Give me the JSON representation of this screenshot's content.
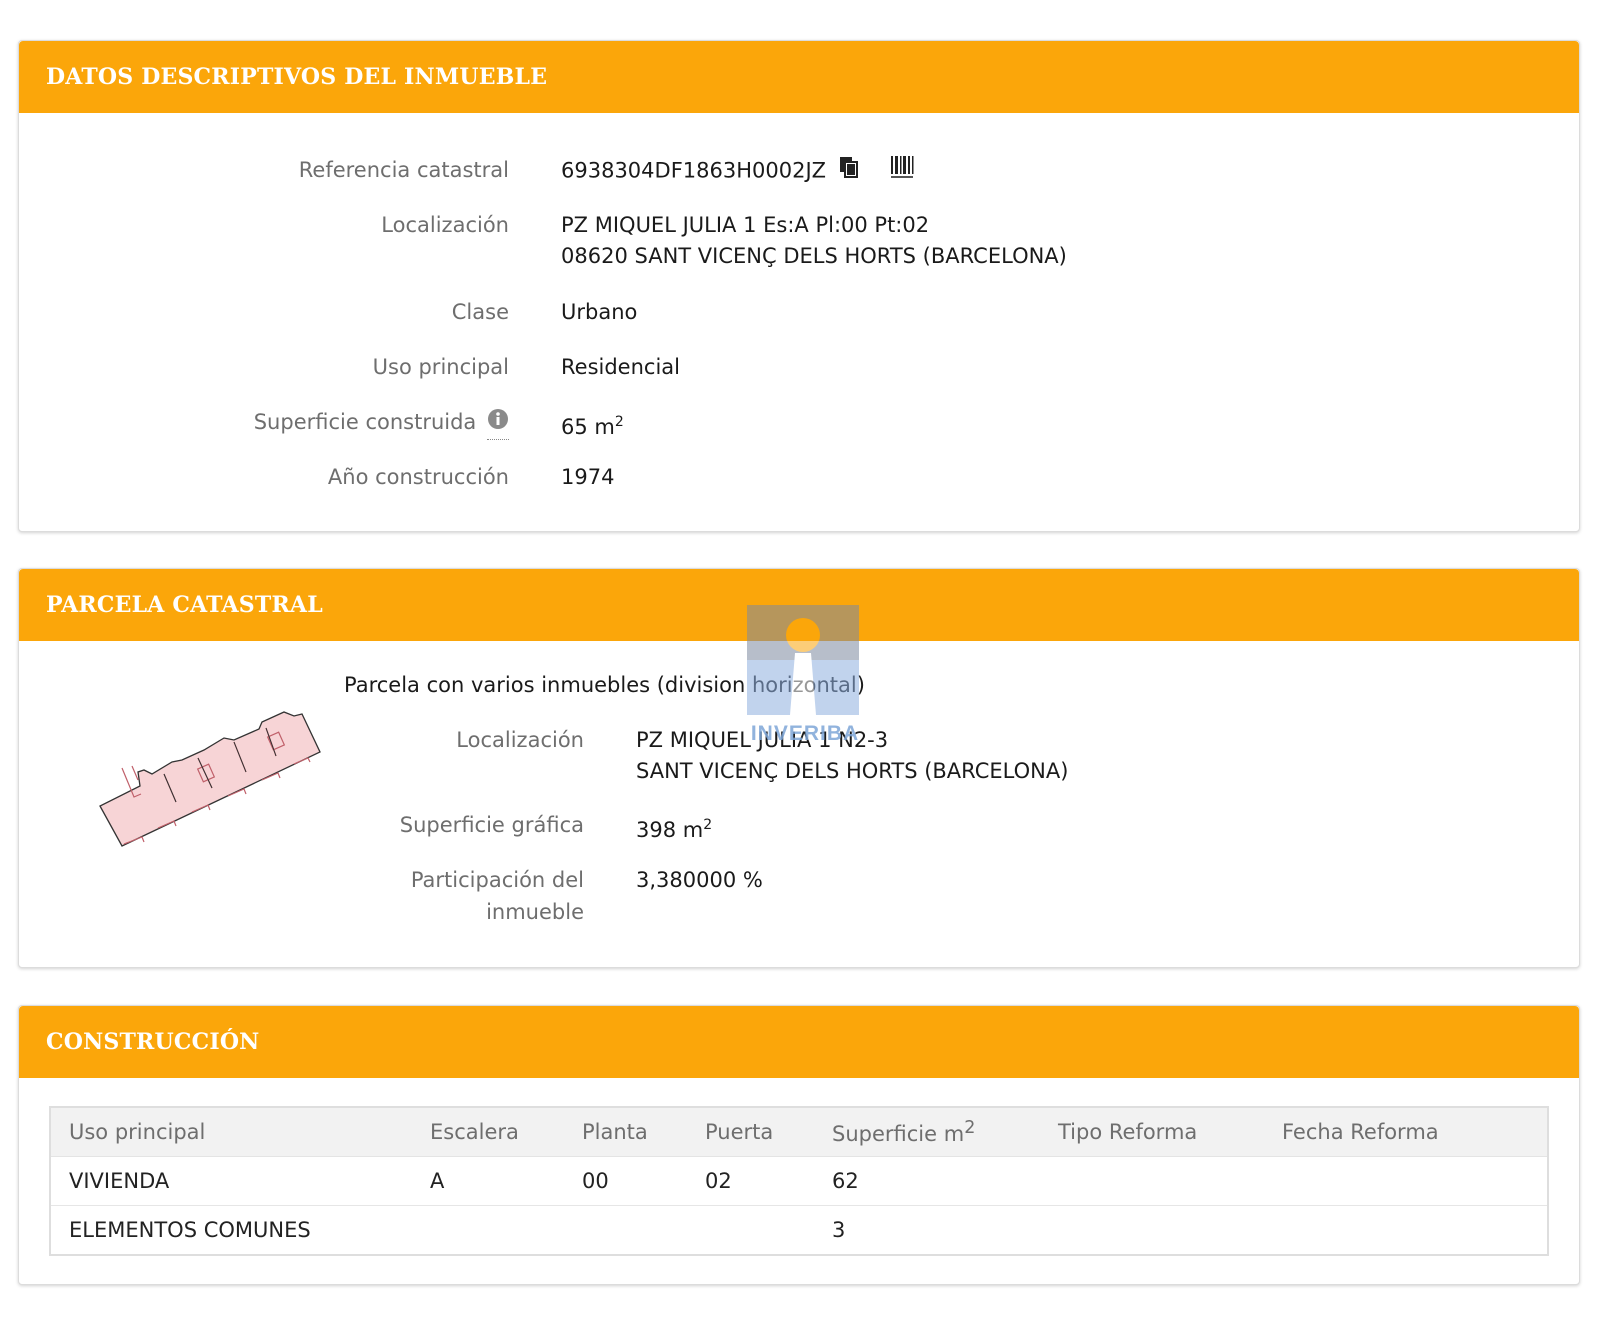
{
  "datos": {
    "title": "DATOS DESCRIPTIVOS DEL INMUEBLE",
    "referencia_label": "Referencia catastral",
    "referencia_value": "6938304DF1863H0002JZ",
    "localizacion_label": "Localización",
    "localizacion_line1": "PZ MIQUEL JULIA 1 Es:A Pl:00 Pt:02",
    "localizacion_line2": "08620 SANT VICENÇ DELS HORTS (BARCELONA)",
    "clase_label": "Clase",
    "clase_value": "Urbano",
    "uso_label": "Uso principal",
    "uso_value": "Residencial",
    "superficie_label": "Superficie construida",
    "superficie_value": "65 m",
    "superficie_sup": "2",
    "anio_label": "Año construcción",
    "anio_value": "1974"
  },
  "parcela": {
    "title": "PARCELA CATASTRAL",
    "heading": "Parcela con varios inmuebles (division horizontal)",
    "localizacion_label": "Localización",
    "localizacion_line1": "PZ MIQUEL JULIA 1 N2-3",
    "localizacion_line2": "SANT VICENÇ DELS HORTS (BARCELONA)",
    "superficie_label": "Superficie gráfica",
    "superficie_value": "398 m",
    "superficie_sup": "2",
    "participacion_label_line1": "Participación del",
    "participacion_label_line2": "inmueble",
    "participacion_value": "3,380000 %"
  },
  "construccion": {
    "title": "CONSTRUCCIÓN",
    "columns": [
      "Uso principal",
      "Escalera",
      "Planta",
      "Puerta",
      "Superficie m",
      "Tipo Reforma",
      "Fecha Reforma"
    ],
    "superficie_sup": "2",
    "rows": [
      [
        "VIVIENDA",
        "A",
        "00",
        "02",
        "62",
        "",
        ""
      ],
      [
        "ELEMENTOS COMUNES",
        "",
        "",
        "",
        "3",
        "",
        ""
      ]
    ]
  },
  "watermark": {
    "text": "INVERIBA"
  },
  "colors": {
    "header": "#fba60a",
    "parcel_fill": "#f7d4d6",
    "parcel_stroke": "#333333"
  },
  "icons": [
    "copy-icon",
    "barcode-icon",
    "info-icon"
  ]
}
